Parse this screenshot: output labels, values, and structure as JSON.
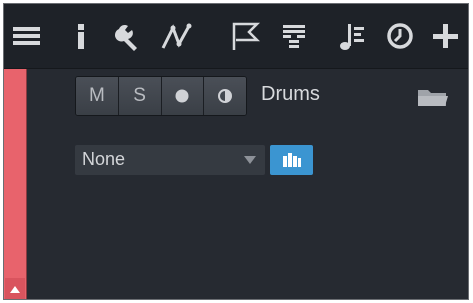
{
  "toolbar": {
    "icons": [
      "menu-icon",
      "info-icon",
      "wrench-icon",
      "automation-icon",
      "marker-flag-icon",
      "patterns-icon",
      "score-icon",
      "clock-icon",
      "add-icon"
    ]
  },
  "track": {
    "color": "#e8636c",
    "buttons": {
      "mute": "M",
      "solo": "S"
    },
    "name": "Drums"
  },
  "instrument": {
    "selected": "None"
  },
  "colors": {
    "accent": "#3b95d1",
    "panel": "#262a31",
    "toolbar": "#1e2228"
  }
}
